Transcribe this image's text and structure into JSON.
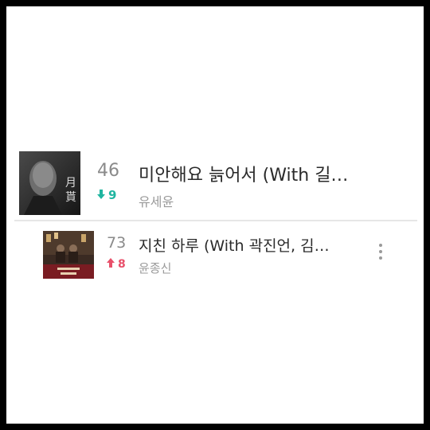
{
  "chart_rows": [
    {
      "rank": "46",
      "change": "9",
      "change_dir": "down",
      "title": "미안해요 늙어서 (With 길…",
      "artist": "유세윤",
      "album_art": "album-art-dark-portrait"
    },
    {
      "rank": "73",
      "change": "8",
      "change_dir": "up",
      "title": "지친 하루 (With 곽진언, 김…",
      "artist": "윤종신",
      "album_art": "album-art-band-photo"
    }
  ],
  "colors": {
    "down": "#1fb5a0",
    "up": "#e8506a"
  }
}
